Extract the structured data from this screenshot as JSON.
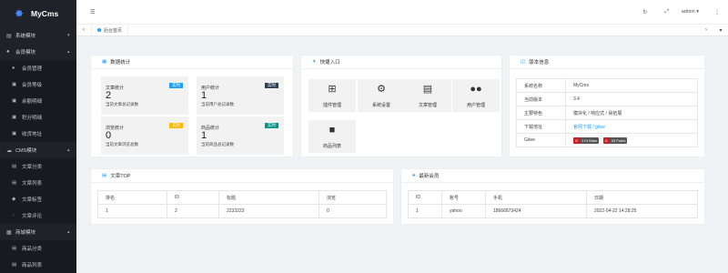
{
  "app": {
    "name": "MyCms",
    "logo_icon": "logo-icon"
  },
  "sidebar": {
    "groups": [
      {
        "label": "系统模块",
        "items": []
      },
      {
        "label": "会员模块",
        "items": [
          {
            "label": "会员管理",
            "icon": "users-icon"
          },
          {
            "label": "会员等级",
            "icon": "level-icon"
          },
          {
            "label": "余额明细",
            "icon": "wallet-icon"
          },
          {
            "label": "积分明细",
            "icon": "points-icon"
          },
          {
            "label": "收货地址",
            "icon": "address-icon"
          }
        ]
      },
      {
        "label": "CMS模块",
        "items": [
          {
            "label": "文章分类",
            "icon": "category-icon"
          },
          {
            "label": "文章列表",
            "icon": "list-icon"
          },
          {
            "label": "文章标签",
            "icon": "tag-icon"
          },
          {
            "label": "文章评论",
            "icon": "comment-icon"
          }
        ]
      },
      {
        "label": "商城模块",
        "items": [
          {
            "label": "商品分类",
            "icon": "category-icon"
          },
          {
            "label": "商品列表",
            "icon": "list-icon"
          }
        ]
      }
    ]
  },
  "topbar": {
    "user": "admin"
  },
  "tabs": [
    {
      "label": "后台首页"
    }
  ],
  "stats": {
    "title": "数据统计",
    "cards": [
      {
        "title": "文章统计",
        "badge": "实时",
        "badge_color": "#1e9fff",
        "value": "2",
        "desc": "当前文章总记录数"
      },
      {
        "title": "用户统计",
        "badge": "实时",
        "badge_color": "#2f4056",
        "value": "1",
        "desc": "当前用户总记录数"
      },
      {
        "title": "浏览统计",
        "badge": "实时",
        "badge_color": "#ffb800",
        "value": "0",
        "desc": "当前文章浏览总数"
      },
      {
        "title": "商品统计",
        "badge": "实时",
        "badge_color": "#009688",
        "value": "1",
        "desc": "当前商品总记录数"
      }
    ]
  },
  "quick": {
    "title": "快捷入口",
    "items": [
      {
        "label": "插件管理",
        "icon": "plugin-icon"
      },
      {
        "label": "系统设置",
        "icon": "gears-icon"
      },
      {
        "label": "文章管理",
        "icon": "file-icon"
      },
      {
        "label": "用户管理",
        "icon": "users-icon"
      },
      {
        "label": "商品列表",
        "icon": "briefcase-icon"
      }
    ]
  },
  "version": {
    "title": "版本信息",
    "rows": [
      {
        "label": "系统名称",
        "value": "MyCms"
      },
      {
        "label": "当前版本",
        "value": "3.4"
      },
      {
        "label": "主要特色",
        "value": "模块化 / 响应式 / 易拓展"
      },
      {
        "label": "下载地址",
        "value": "官网下载 / gitee"
      },
      {
        "label": "Gitee",
        "value": ""
      }
    ],
    "gitee_badges": [
      {
        "left": "G",
        "right": "174 Stars"
      },
      {
        "left": "G",
        "right": "33 Forks"
      }
    ]
  },
  "top_articles": {
    "title": "文章TOP",
    "columns": [
      "排名",
      "ID",
      "标题",
      "浏览"
    ],
    "rows": [
      [
        "1",
        "2",
        "2233223",
        "0"
      ]
    ]
  },
  "latest_members": {
    "title": "最新会员",
    "columns": [
      "ID",
      "账号",
      "手机",
      "日期"
    ],
    "rows": [
      [
        "1",
        "yahoo",
        "18666873424",
        "2022-04-22 14:28:25"
      ]
    ]
  },
  "colors": {
    "sidebar_bg": "#20222a",
    "accent": "#1e9fff"
  }
}
